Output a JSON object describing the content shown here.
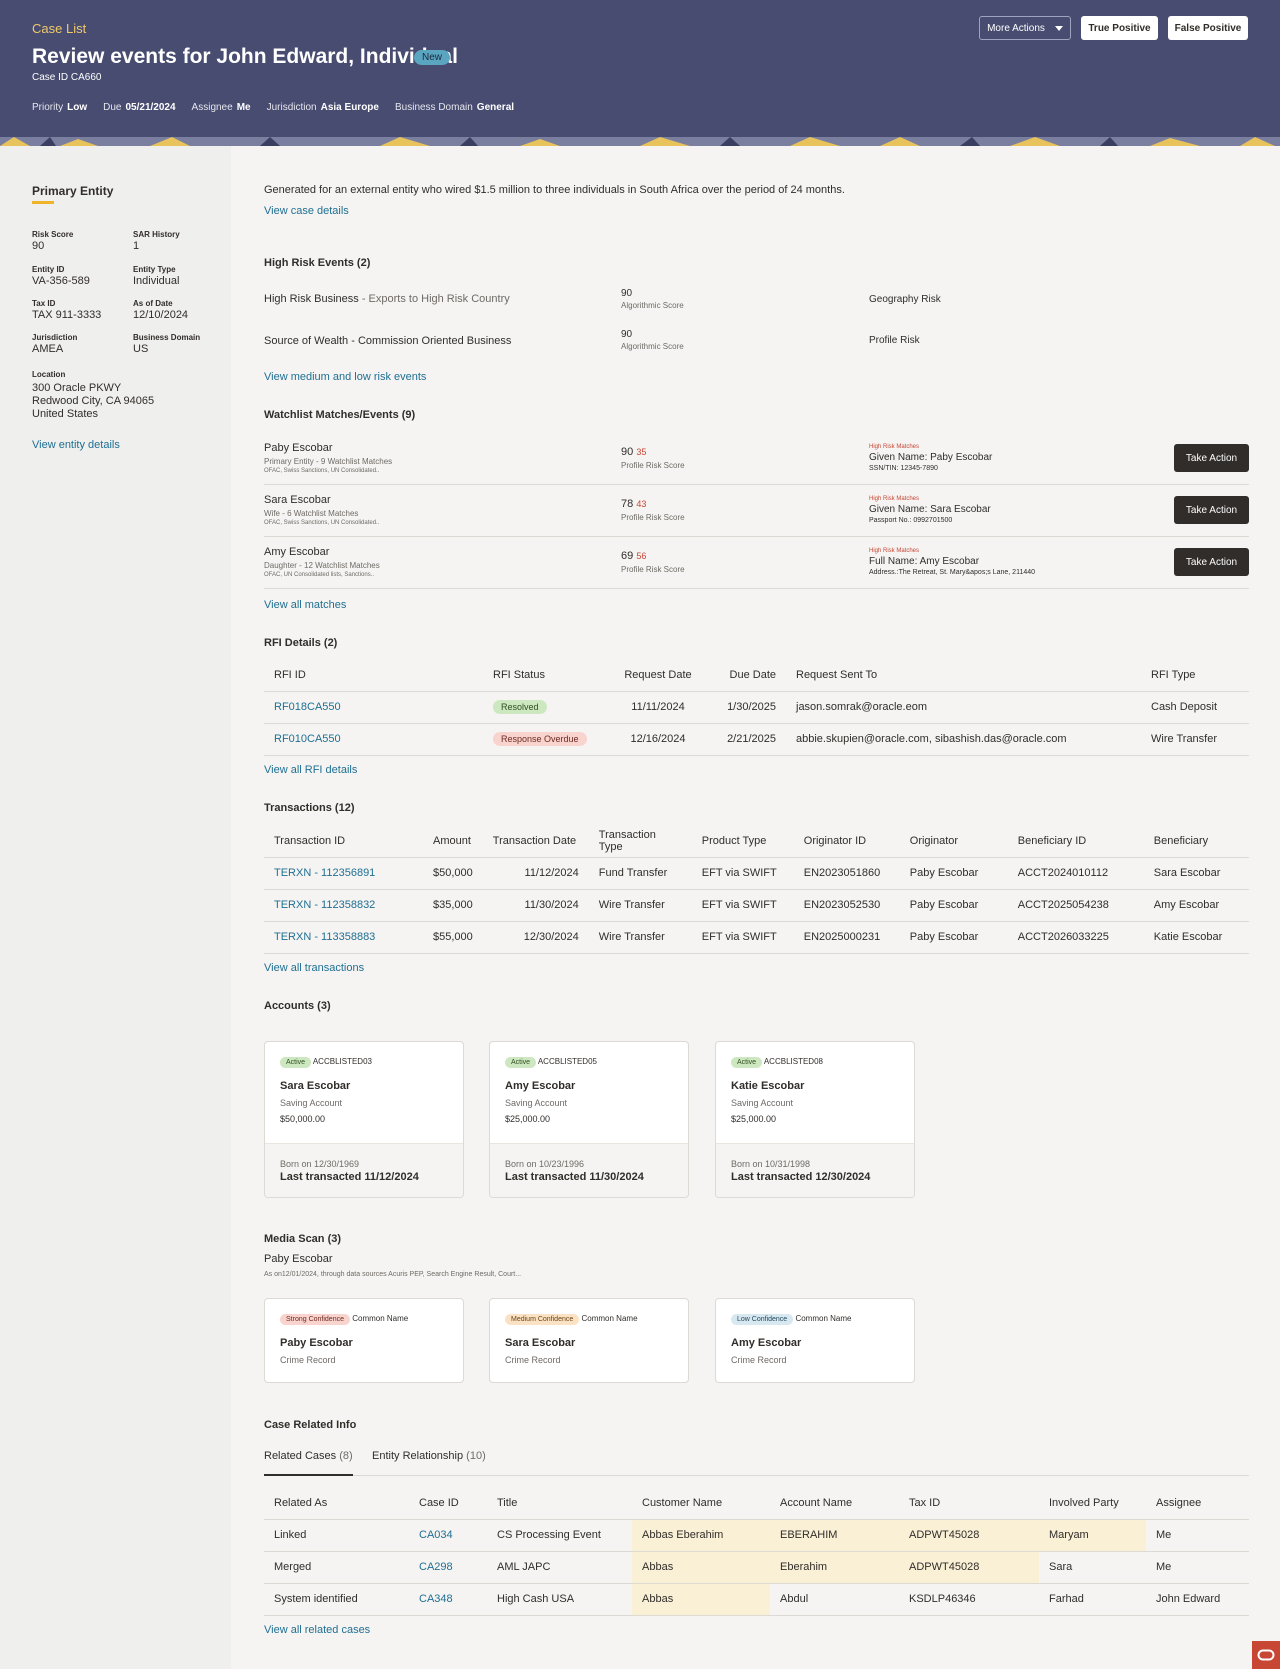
{
  "header": {
    "breadcrumb": "Case List",
    "title": "Review events for John Edward, Individual",
    "status_badge": "New",
    "case_id": "Case ID CA660",
    "meta": [
      {
        "key": "Priority",
        "value": "Low"
      },
      {
        "key": "Due",
        "value": "05/21/2024"
      },
      {
        "key": "Assignee",
        "value": "Me"
      },
      {
        "key": "Jurisdiction",
        "value": "Asia Europe"
      },
      {
        "key": "Business Domain",
        "value": "General"
      }
    ],
    "more_actions": "More Actions",
    "true_positive": "True Positive",
    "false_positive": "False Positive"
  },
  "sidebar": {
    "title": "Primary Entity",
    "fields": [
      {
        "key": "Risk Score",
        "value": "90"
      },
      {
        "key": "SAR History",
        "value": "1"
      },
      {
        "key": "Entity ID",
        "value": "VA-356-589"
      },
      {
        "key": "Entity Type",
        "value": "Individual"
      },
      {
        "key": "Tax ID",
        "value": "TAX 911-3333"
      },
      {
        "key": "As of Date",
        "value": "12/10/2024"
      },
      {
        "key": "Jurisdiction",
        "value": "AMEA"
      },
      {
        "key": "Business Domain",
        "value": "US"
      }
    ],
    "location_label": "Location",
    "location_line1": "300 Oracle PKWY",
    "location_line2": "Redwood City, CA 94065",
    "location_line3": "United States",
    "view_entity": "View entity details"
  },
  "summary": {
    "text": "Generated for an external entity who wired $1.5 million to three individuals in South Africa over the period of 24 months.",
    "view_case": "View case details"
  },
  "high_risk": {
    "title": "High Risk Events (2)",
    "rows": [
      {
        "name": "High Risk Business",
        "detail": " - Exports to High Risk Country",
        "score": "90",
        "score_label": "Algorithmic Score",
        "risk": "Geography Risk"
      },
      {
        "name": "Source of Wealth - Commission Oriented Business",
        "detail": "",
        "score": "90",
        "score_label": "Algorithmic Score",
        "risk": "Profile Risk"
      }
    ],
    "view_more": "View medium and low risk events"
  },
  "watchlist": {
    "title": "Watchlist Matches/Events (9)",
    "rows": [
      {
        "name": "Paby Escobar",
        "sub": "Primary Entity - 9 Watchlist Matches",
        "sources": "OFAC, Swiss Sanctions, UN Consolidated..",
        "score": "90",
        "score_delta": "35",
        "score_label": "Profile Risk Score",
        "match_label": "High Risk Matches",
        "match_name": "Given Name: Paby Escobar",
        "match_detail": "SSN/TIN: 12345-7890",
        "action": "Take Action"
      },
      {
        "name": "Sara Escobar",
        "sub": "Wife - 6 Watchlist Matches",
        "sources": "OFAC, Swiss Sanctions, UN Consolidated..",
        "score": "78",
        "score_delta": "43",
        "score_label": "Profile Risk Score",
        "match_label": "High Risk Matches",
        "match_name": "Given Name: Sara Escobar",
        "match_detail": "Passport No.: 0992701500",
        "action": "Take Action"
      },
      {
        "name": "Amy Escobar",
        "sub": "Daughter - 12 Watchlist Matches",
        "sources": "OFAC, UN Consolidated lists, Sanctions..",
        "score": "69",
        "score_delta": "56",
        "score_label": "Profile Risk Score",
        "match_label": "High Risk Matches",
        "match_name": "Full Name: Amy Escobar",
        "match_detail": "Address.:The Retreat, St. Mary&apos;s Lane, 211440",
        "action": "Take Action"
      }
    ],
    "view_all": "View all matches"
  },
  "rfi": {
    "title": "RFI Details (2)",
    "headers": [
      "RFI ID",
      "RFI Status",
      "Request Date",
      "Due Date",
      "Request Sent To",
      "RFI Type"
    ],
    "rows": [
      {
        "id": "RF018CA550",
        "status": "Resolved",
        "request_date": "11/11/2024",
        "due_date": "1/30/2025",
        "sent_to": "jason.somrak@oracle.eom",
        "type": "Cash Deposit"
      },
      {
        "id": "RF010CA550",
        "status": "Response Overdue",
        "request_date": "12/16/2024",
        "due_date": "2/21/2025",
        "sent_to": "abbie.skupien@oracle.com, sibashish.das@oracle.com",
        "type": "Wire Transfer"
      }
    ],
    "view_all": "View all RFI details"
  },
  "transactions": {
    "title": "Transactions (12)",
    "headers": [
      "Transaction ID",
      "Amount",
      "Transaction Date",
      "Transaction Type",
      "Product Type",
      "Originator ID",
      "Originator",
      "Beneficiary ID",
      "Beneficiary"
    ],
    "rows": [
      [
        "TERXN - 112356891",
        "$50,000",
        "11/12/2024",
        "Fund Transfer",
        "EFT via SWIFT",
        "EN2023051860",
        "Paby Escobar",
        "ACCT2024010112",
        "Sara Escobar"
      ],
      [
        "TERXN - 112358832",
        "$35,000",
        "11/30/2024",
        "Wire Transfer",
        "EFT via SWIFT",
        "EN2023052530",
        "Paby Escobar",
        "ACCT2025054238",
        "Amy Escobar"
      ],
      [
        "TERXN - 113358883",
        "$55,000",
        "12/30/2024",
        "Wire Transfer",
        "EFT via SWIFT",
        "EN2025000231",
        "Paby Escobar",
        "ACCT2026033225",
        "Katie Escobar"
      ]
    ],
    "view_all": "View all transactions"
  },
  "accounts": {
    "title": "Accounts (3)",
    "cards": [
      {
        "status": "Active",
        "id": "ACCBLISTED03",
        "name": "Sara Escobar",
        "type": "Saving Account",
        "amount": "$50,000.00",
        "born": "Born on 12/30/1969",
        "last": "Last transacted 11/12/2024"
      },
      {
        "status": "Active",
        "id": "ACCBLISTED05",
        "name": "Amy Escobar",
        "type": "Saving Account",
        "amount": "$25,000.00",
        "born": "Born on 10/23/1996",
        "last": "Last transacted 11/30/2024"
      },
      {
        "status": "Active",
        "id": "ACCBLISTED08",
        "name": "Katie Escobar",
        "type": "Saving Account",
        "amount": "$25,000.00",
        "born": "Born on 10/31/1998",
        "last": "Last transacted 12/30/2024"
      }
    ]
  },
  "media": {
    "title": "Media Scan (3)",
    "subject": "Paby Escobar",
    "note": "As on12/01/2024, through data sources Acuris PEP,  Search Engine Result, Court...",
    "cards": [
      {
        "confidence": "Strong Confidence",
        "kind": "Common Name",
        "name": "Paby Escobar",
        "record": "Crime Record"
      },
      {
        "confidence": "Medium Confidence",
        "kind": "Common Name",
        "name": "Sara Escobar",
        "record": "Crime Record"
      },
      {
        "confidence": "Low Confidence",
        "kind": "Common Name",
        "name": "Amy Escobar",
        "record": "Crime Record"
      }
    ]
  },
  "related": {
    "title": "Case Related Info",
    "tab1": "Related Cases",
    "tab1_count": "(8)",
    "tab2": "Entity Relationship",
    "tab2_count": "(10)",
    "headers": [
      "Related As",
      "Case ID",
      "Title",
      "Customer Name",
      "Account Name",
      "Tax ID",
      "Involved Party",
      "Assignee"
    ],
    "rows": [
      [
        "Linked",
        "CA034",
        "CS Processing Event",
        "Abbas Eberahim",
        "EBERAHIM",
        "ADPWT45028",
        "Maryam",
        "Me"
      ],
      [
        "Merged",
        "CA298",
        "AML JAPC",
        "Abbas",
        "Eberahim",
        "ADPWT45028",
        "Sara",
        "Me"
      ],
      [
        "System identified",
        "CA348",
        "High Cash USA",
        "Abbas",
        "Abdul",
        "KSDLP46346",
        "Farhad",
        "John Edward"
      ]
    ],
    "view_all": "View all related cases"
  },
  "colors": {
    "header_bg": "#474c70",
    "accent_yellow": "#f0c96b",
    "link": "#1f6f93",
    "dark_button": "#312d2a",
    "risk_red": "#c74634"
  }
}
